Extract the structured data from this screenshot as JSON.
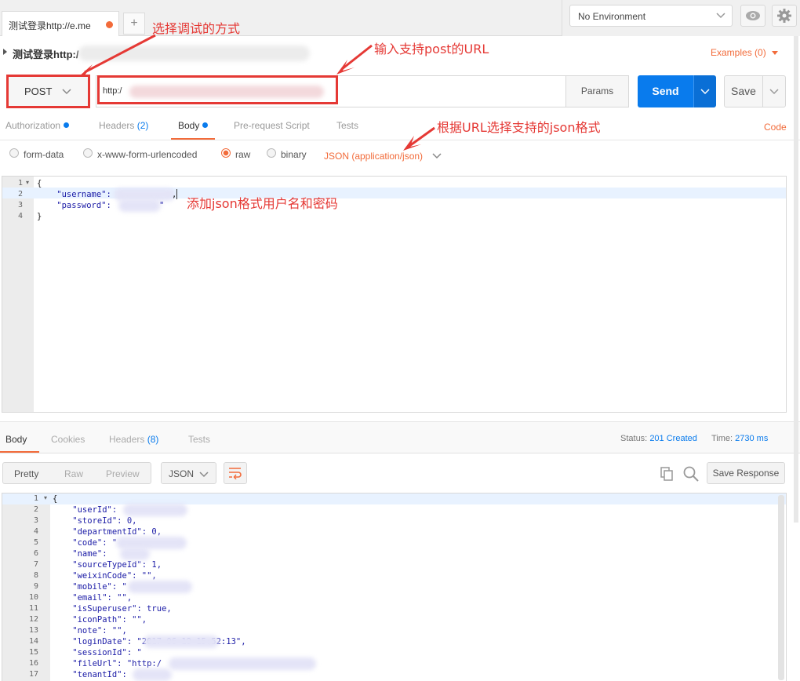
{
  "tab": {
    "label": "测试登录http://e.me",
    "add": "+"
  },
  "environment": {
    "selected": "No Environment"
  },
  "request": {
    "title": "测试登录http:/",
    "examples": "Examples (0)",
    "method": "POST",
    "url": "http:/",
    "params_label": "Params",
    "send_label": "Send",
    "save_label": "Save"
  },
  "request_tabs": [
    {
      "label": "Authorization"
    },
    {
      "label": "Headers",
      "count": "(2)"
    },
    {
      "label": "Body"
    },
    {
      "label": "Pre-request Script"
    },
    {
      "label": "Tests"
    }
  ],
  "code_link": "Code",
  "body_types": [
    "form-data",
    "x-www-form-urlencoded",
    "raw",
    "binary"
  ],
  "body_type_selected": "raw",
  "content_type": "JSON (application/json)",
  "request_body": {
    "line_numbers": [
      "1",
      "2",
      "3",
      "4"
    ],
    "lines": [
      "{",
      "    \"username\":",
      "    \"password\":",
      "}"
    ],
    "username_tail": ",",
    "password_tail": "\""
  },
  "response_tabs": [
    {
      "label": "Body"
    },
    {
      "label": "Cookies"
    },
    {
      "label": "Headers",
      "count": "(8)"
    },
    {
      "label": "Tests"
    }
  ],
  "status": {
    "label": "Status:",
    "value": "201 Created",
    "time_label": "Time:",
    "time_value": "2730 ms"
  },
  "view_modes": [
    "Pretty",
    "Raw",
    "Preview"
  ],
  "format": "JSON",
  "save_response": "Save Response",
  "response_body": {
    "line_numbers": [
      "1",
      "2",
      "3",
      "4",
      "5",
      "6",
      "7",
      "8",
      "9",
      "10",
      "11",
      "12",
      "13",
      "14",
      "15",
      "16",
      "17"
    ],
    "lines": [
      "{",
      "    \"userId\":",
      "    \"storeId\": 0,",
      "    \"departmentId\": 0,",
      "    \"code\": \"",
      "    \"name\":",
      "    \"sourceTypeId\": 1,",
      "    \"weixinCode\": \"\",",
      "    \"mobile\": \"",
      "    \"email\": \"\",",
      "    \"isSuperuser\": true,",
      "    \"iconPath\": \"\",",
      "    \"note\": \"\",",
      "    \"loginDate\": \"2017-06-19 15:52:13\",",
      "    \"sessionId\": \"",
      "    \"fileUrl\": \"http:/",
      "    \"tenantId\":"
    ]
  },
  "annotations": {
    "method": "选择调试的方式",
    "url": "输入支持post的URL",
    "json": "根据URL选择支持的json格式",
    "body": "添加json格式用户名和密码"
  },
  "colors": {
    "accent": "#f26b3a",
    "primary": "#097bed",
    "annotation": "#e53935"
  }
}
